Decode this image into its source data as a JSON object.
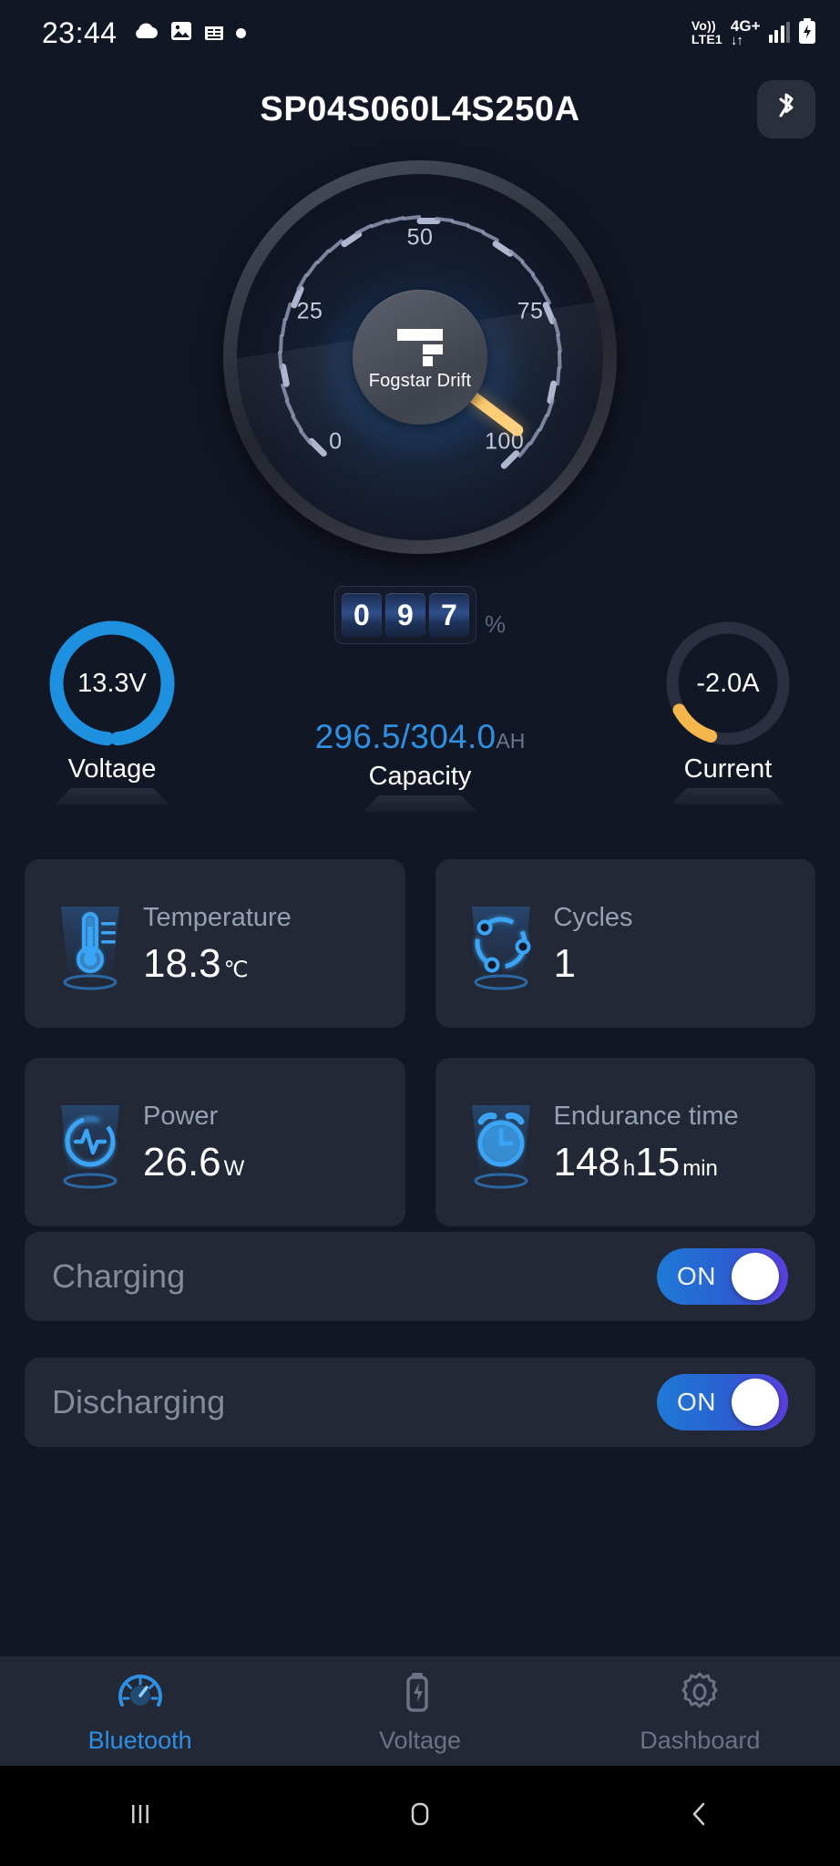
{
  "statusbar": {
    "time": "23:44",
    "icons": [
      "cloud-icon",
      "photo-icon",
      "calendar-icon",
      "dot-icon"
    ],
    "volte": "Vo))",
    "network_tech": "LTE1",
    "network_gen": "4G+",
    "data_arrows": "↓↑",
    "signal_bars": 3,
    "battery": "charging"
  },
  "header": {
    "title": "SP04S060L4S250A",
    "bluetooth_button": "bluetooth-icon"
  },
  "gauge": {
    "scale_labels": [
      "0",
      "25",
      "50",
      "75",
      "100"
    ],
    "min": 0,
    "max": 100,
    "value": 97,
    "needle_color": "#f5b74c",
    "brand_name": "Fogstar Drift",
    "odometer_digits": [
      "0",
      "9",
      "7"
    ],
    "percent_symbol": "%"
  },
  "metrics": {
    "voltage": {
      "value": "13.3V",
      "label": "Voltage",
      "ring_color": "#1e90e0",
      "ring_pct": 97
    },
    "capacity": {
      "value": "296.5/304.0",
      "unit": "AH",
      "label": "Capacity",
      "color": "#2f8fe0"
    },
    "current": {
      "value": "-2.0A",
      "label": "Current",
      "ring_color": "#f5b74c",
      "ring_pct": 12
    }
  },
  "cards": [
    {
      "icon": "thermometer-icon",
      "title": "Temperature",
      "value": "18.3",
      "unit": "℃"
    },
    {
      "icon": "cycles-icon",
      "title": "Cycles",
      "value": "1",
      "unit": ""
    },
    {
      "icon": "power-pulse-icon",
      "title": "Power",
      "value": "26.6",
      "unit": "W"
    },
    {
      "icon": "alarm-clock-icon",
      "title": "Endurance time",
      "value": "148",
      "unit": "h",
      "value2": "15",
      "unit2": "min"
    }
  ],
  "switches": [
    {
      "label": "Charging",
      "state": "ON"
    },
    {
      "label": "Discharging",
      "state": "ON"
    }
  ],
  "bottom_nav": [
    {
      "icon": "speedometer-icon",
      "label": "Bluetooth",
      "active": true
    },
    {
      "icon": "battery-bolt-icon",
      "label": "Voltage",
      "active": false
    },
    {
      "icon": "gear-icon",
      "label": "Dashboard",
      "active": false
    }
  ],
  "android_nav": [
    "recents-icon",
    "home-icon",
    "back-icon"
  ]
}
